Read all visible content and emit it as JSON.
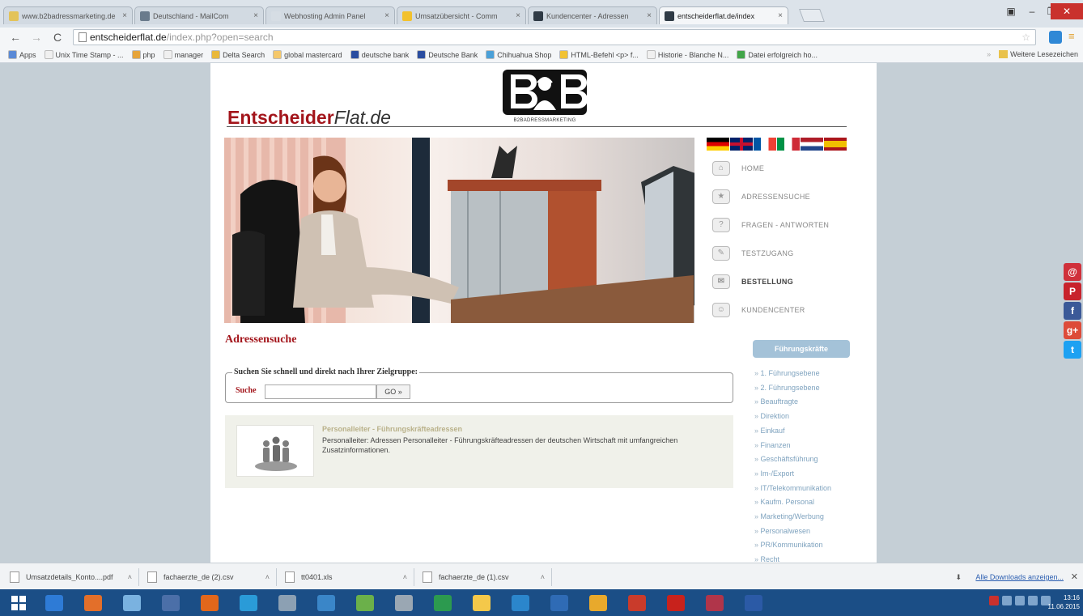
{
  "browser": {
    "tabs": [
      {
        "label": "www.b2badressmarketing.de",
        "color": "#e3c35a"
      },
      {
        "label": "Deutschland - MailCom",
        "color": "#6a7b8c"
      },
      {
        "label": "Webhosting Admin Panel",
        "color": "#d6dde4"
      },
      {
        "label": "Umsatzübersicht - Comm",
        "color": "#f2c12e"
      },
      {
        "label": "Kundencenter - Adressen",
        "color": "#2f3a45"
      },
      {
        "label": "entscheiderflat.de/index",
        "color": "#2f3a45"
      }
    ],
    "url_host": "entscheiderflat.de",
    "url_path": "/index.php?open=search",
    "bookmarks": [
      {
        "label": "Apps",
        "color": "#5b8ad6"
      },
      {
        "label": "Unix Time Stamp - ...",
        "color": "#f0f0f0"
      },
      {
        "label": "php",
        "color": "#e6a43a"
      },
      {
        "label": "manager",
        "color": "#f0f0f0"
      },
      {
        "label": "Delta Search",
        "color": "#e9b83b"
      },
      {
        "label": "global mastercard",
        "color": "#f5c86b"
      },
      {
        "label": "deutsche bank",
        "color": "#2a4da0"
      },
      {
        "label": "Deutsche Bank",
        "color": "#2a4da0"
      },
      {
        "label": "Chihuahua Shop",
        "color": "#4aa0d8"
      },
      {
        "label": "HTML-Befehl <p> f...",
        "color": "#f1c232"
      },
      {
        "label": "Historie - Blanche N...",
        "color": "#f0f0f0"
      },
      {
        "label": "Datei erfolgreich ho...",
        "color": "#41a548"
      }
    ],
    "other_bookmarks": "Weitere Lesezeichen"
  },
  "site": {
    "logo_main": "Entscheider",
    "logo_italic": "Flat.de",
    "b2b_tagline": "B2BADRESSMARKETING",
    "flags": [
      {
        "name": "de",
        "colors": [
          "#000000",
          "#dd0000",
          "#ffce00"
        ]
      },
      {
        "name": "uk",
        "colors": [
          "#012169",
          "#c8102e",
          "#ffffff"
        ]
      },
      {
        "name": "fr",
        "colors": [
          "#0055a4",
          "#ffffff",
          "#ef4135"
        ]
      },
      {
        "name": "it",
        "colors": [
          "#009246",
          "#ffffff",
          "#ce2b37"
        ]
      },
      {
        "name": "nl",
        "colors": [
          "#ae1c28",
          "#ffffff",
          "#21468b"
        ]
      },
      {
        "name": "es",
        "colors": [
          "#aa151b",
          "#f1bf00",
          "#aa151b"
        ]
      }
    ],
    "nav": [
      {
        "label": "HOME",
        "icon": "⌂"
      },
      {
        "label": "ADRESSENSUCHE",
        "icon": "★"
      },
      {
        "label": "FRAGEN - ANTWORTEN",
        "icon": "?"
      },
      {
        "label": "TESTZUGANG",
        "icon": "✎"
      },
      {
        "label": "BESTELLUNG",
        "icon": "✉"
      },
      {
        "label": "KUNDENCENTER",
        "icon": "☺"
      }
    ],
    "section_title": "Adressensuche",
    "search": {
      "legend": "Suchen Sie schnell und direkt nach Ihrer Zielgruppe:",
      "label": "Suche",
      "value": "",
      "go": "GO »"
    },
    "result": {
      "title": "Personalleiter - Führungskräfteadressen",
      "description": "Personalleiter: Adressen Personalleiter - Führungskräfteadressen der deutschen Wirtschaft mit umfangreichen Zusatzinformationen."
    },
    "category_button": "Führungskräfte",
    "categories": [
      "1. Führungsebene",
      "2. Führungsebene",
      "Beauftragte",
      "Direktion",
      "Einkauf",
      "Finanzen",
      "Geschäftsführung",
      "Im-/Export",
      "IT/Telekommunikation",
      "Kaufm. Personal",
      "Marketing/Werbung",
      "Personalwesen",
      "PR/Kommunikation",
      "Recht"
    ]
  },
  "social": [
    {
      "name": "email",
      "glyph": "@",
      "color": "#d0303a"
    },
    {
      "name": "pinterest",
      "glyph": "P",
      "color": "#c8232c"
    },
    {
      "name": "facebook",
      "glyph": "f",
      "color": "#3b5998"
    },
    {
      "name": "google-plus",
      "glyph": "g+",
      "color": "#dd4b39"
    },
    {
      "name": "twitter",
      "glyph": "t",
      "color": "#1da1f2"
    }
  ],
  "downloads": [
    {
      "label": "Umsatzdetails_Konto....pdf"
    },
    {
      "label": "fachaerzte_de (2).csv"
    },
    {
      "label": "tt0401.xls"
    },
    {
      "label": "fachaerzte_de (1).csv"
    }
  ],
  "downloads_all": "Alle Downloads anzeigen...",
  "taskbar_colors": [
    "#2e7bd6",
    "#e36f2a",
    "#7ab2e0",
    "#4b6fa8",
    "#e2671b",
    "#2a9bd8",
    "#8ca0b3",
    "#3a86c8",
    "#6bb04a",
    "#9aa7b3",
    "#2c9a4f",
    "#f4c84a",
    "#2b86cc",
    "#2f6bb5",
    "#e8a92c",
    "#c93b2b",
    "#c8221c",
    "#b0354a",
    "#2b5aa6"
  ],
  "clock": {
    "time": "13:16",
    "date": "11.06.2015"
  }
}
